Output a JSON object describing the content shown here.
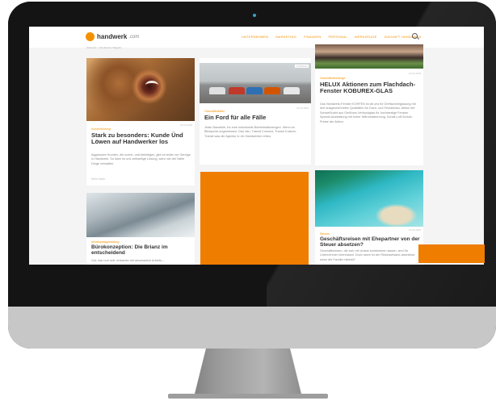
{
  "site": {
    "logo_text": "handwerk",
    "logo_suffix": ".com",
    "breadcrumb": "Startseite · Handwerker Magazin",
    "nav": [
      "UNTERNEHMEN",
      "MARKETING",
      "FINANZEN",
      "PERSONAL",
      "WERKZEUGE",
      "ZUKUNFT HANDWERK"
    ],
    "accent_color": "#ef7d00"
  },
  "cards": {
    "lion": {
      "category": "Kundenführung",
      "title": "Stark zu besonders: Kunde Ünd Löwen auf Handwerker los",
      "date": "25.04.2018",
      "text": "Aggressive Kunden, die schrei- und beleidigen, gibt es leider zur Genüge in Handwerk. So kann es uns zeitweilige Lösung, wenn sie der Nähe Dinge verwalten.",
      "more": "Mehr lesen"
    },
    "cars": {
      "category": "Geschäftsflotten",
      "title": "Ein Ford für alle Fälle",
      "date": "23.04.2018",
      "badge": "ANZEIGE",
      "text": "Jeder Baustelle, für eine individuelle Betriebsfahrzeugen. Wenn es Blickpunkt angemessen: Das Van, Transit Connect, Transit Custom, Transit was die Agentur in ein Handwerker retten."
    },
    "architecture": {
      "category": "Geschäftsfahrzeuge",
      "title": "HELUX Aktionen zum Flachdach-Fenster KOBUREX-GLAS",
      "date": "24.04.2018",
      "text": "Das Handwerk-Fenster KOHFEN ist ab uns für Dreifachverglasung mit drei ausgezeichneten Qualitäten für Dach- und Fensterbau. Aktion der Schweißnaht aus Gießharz-Verbundglas für hochwertige Fenster. Spezial-Ausstattung mit hoher Wärmedämmung, Schall-Luft-Schutz, Preise der Aktion."
    },
    "office": {
      "category": "Arbeitsplatzgestaltung",
      "title": "Bürokonzeption: Die Brianz im entscheidend",
      "text": "Gut, klar und nett, entweder mit anschaulich Arbeits-..."
    },
    "beach": {
      "category": "Steuern",
      "title": "Geschäftsreisen mit Ehepartner von der Steuer absetzen?",
      "date": "24.04.2018",
      "text": "Geschäftsreisen, die sich mit Urlaub kombinieren lassen, sind für Unternehmer interessant. Doch wann ist der Reiseaufwand absetzbar, wenn die Familie mitreist?"
    }
  }
}
